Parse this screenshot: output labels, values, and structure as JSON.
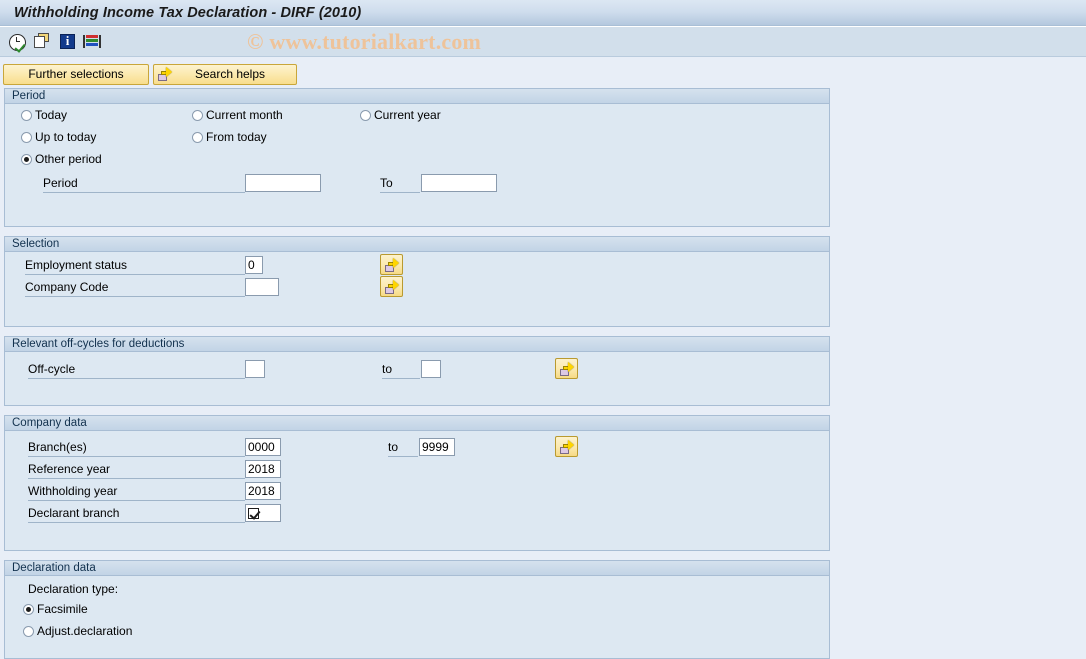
{
  "window": {
    "title": "Withholding Income Tax Declaration - DIRF (2010)"
  },
  "watermark": {
    "text": "© www.tutorialkart.com",
    "color": "#eec39a"
  },
  "toolbar": {
    "icons": [
      {
        "name": "execute-clock-icon"
      },
      {
        "name": "copy-variant-icon"
      },
      {
        "name": "information-icon"
      },
      {
        "name": "color-bars-icon"
      }
    ]
  },
  "action_buttons": {
    "further_selections": "Further selections",
    "search_helps": "Search helps"
  },
  "sections": {
    "period": {
      "header": "Period",
      "options": [
        {
          "label": "Today",
          "selected": false
        },
        {
          "label": "Current month",
          "selected": false
        },
        {
          "label": "Current year",
          "selected": false
        },
        {
          "label": "Up to today",
          "selected": false
        },
        {
          "label": "From today",
          "selected": false
        },
        {
          "label": "Other period",
          "selected": true
        }
      ],
      "period_label": "Period",
      "period_value": "",
      "to_label": "To",
      "to_value": ""
    },
    "selection": {
      "header": "Selection",
      "employment_status_label": "Employment status",
      "employment_status_value": "0",
      "company_code_label": "Company Code",
      "company_code_value": "",
      "picker_icon": "multiple-selection-icon"
    },
    "offcycles": {
      "header": "Relevant off-cycles for deductions",
      "offcycle_label": "Off-cycle",
      "offcycle_value": "",
      "to_label": "to",
      "to_value": "",
      "picker_icon": "multiple-selection-icon"
    },
    "company_data": {
      "header": "Company data",
      "branches_label": "Branch(es)",
      "branches_value": "0000",
      "to_label": "to",
      "branches_to_value": "9999",
      "reference_year_label": "Reference year",
      "reference_year_value": "2018",
      "withholding_year_label": "Withholding year",
      "withholding_year_value": "2018",
      "declarant_branch_label": "Declarant branch",
      "declarant_branch_checked": true,
      "picker_icon": "multiple-selection-icon"
    },
    "declaration_data": {
      "header": "Declaration data",
      "type_label": "Declaration type:",
      "options": [
        {
          "label": "Facsimile",
          "selected": true
        },
        {
          "label": "Adjust.declaration",
          "selected": false
        }
      ]
    }
  }
}
